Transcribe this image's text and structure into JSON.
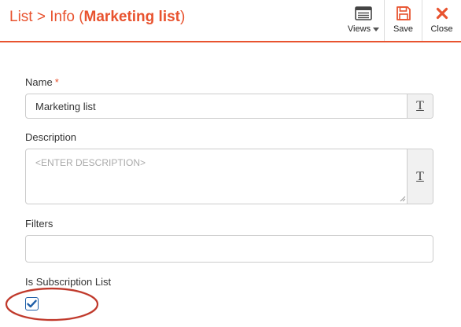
{
  "header": {
    "title_prefix": "List > Info (",
    "title_name": "Marketing list",
    "title_suffix": ")",
    "views_label": "Views",
    "save_label": "Save",
    "close_label": "Close"
  },
  "form": {
    "name": {
      "label": "Name",
      "required_mark": "*",
      "value": "Marketing list",
      "text_button": "T"
    },
    "description": {
      "label": "Description",
      "placeholder": "<ENTER DESCRIPTION>",
      "text_button": "T"
    },
    "filters": {
      "label": "Filters",
      "value": ""
    },
    "subscription": {
      "label": "Is Subscription List",
      "checked": true
    }
  },
  "colors": {
    "accent": "#e8532f",
    "checkbox": "#1f5fa8",
    "highlight_ring": "#c0392b"
  },
  "icons": {
    "views": "list-window-icon",
    "save": "floppy-disk-icon",
    "close": "x-icon",
    "text": "text-format-icon",
    "check": "check-icon"
  }
}
